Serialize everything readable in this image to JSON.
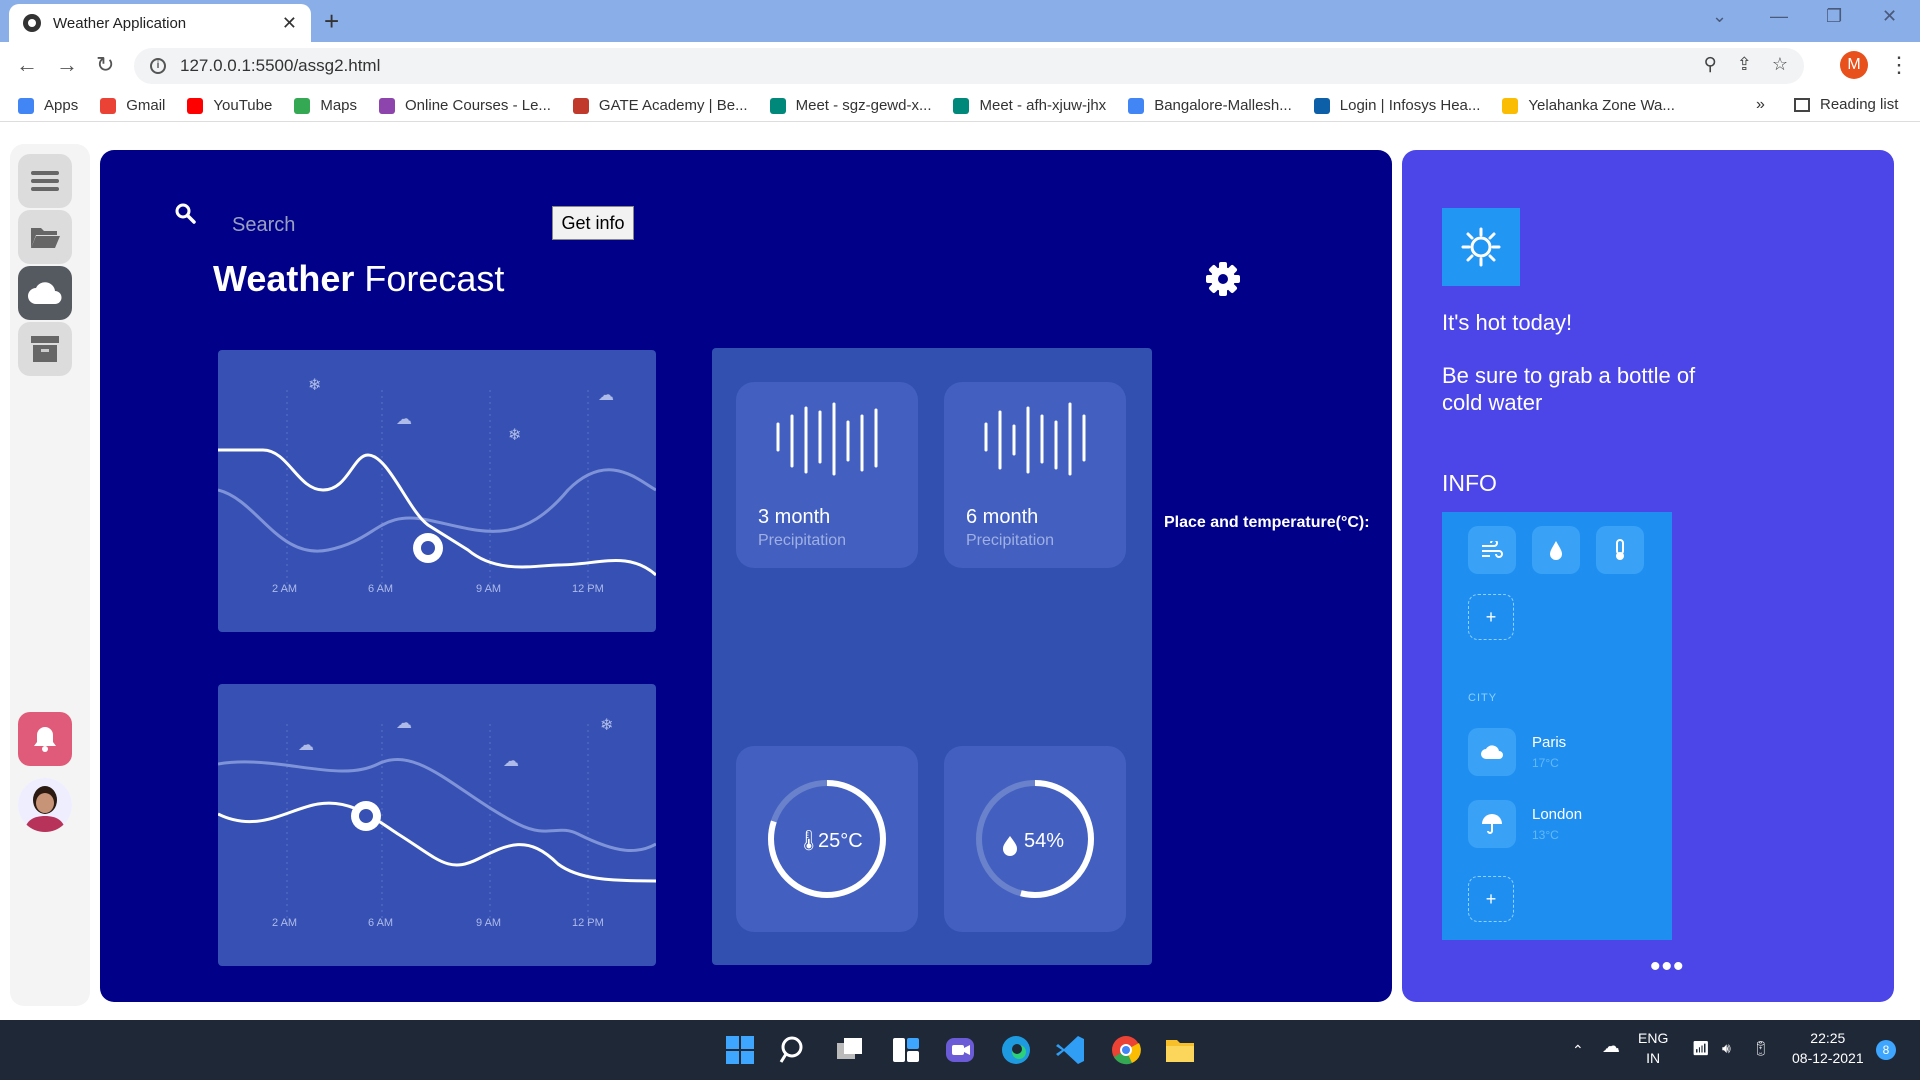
{
  "browser": {
    "tab_title": "Weather Application",
    "tab_close": "✕",
    "new_tab": "+",
    "url": "127.0.0.1:5500/assg2.html",
    "profile_initial": "M",
    "bookmarks": [
      {
        "label": "Apps",
        "color": "#4285f4"
      },
      {
        "label": "Gmail",
        "color": "#ea4335"
      },
      {
        "label": "YouTube",
        "color": "#ff0000"
      },
      {
        "label": "Maps",
        "color": "#34a853"
      },
      {
        "label": "Online Courses - Le...",
        "color": "#8e44ad"
      },
      {
        "label": "GATE Academy | Be...",
        "color": "#c0392b"
      },
      {
        "label": "Meet - sgz-gewd-x...",
        "color": "#00897b"
      },
      {
        "label": "Meet - afh-xjuw-jhx",
        "color": "#00897b"
      },
      {
        "label": "Bangalore-Mallesh...",
        "color": "#4285f4"
      },
      {
        "label": "Login | Infosys Hea...",
        "color": "#0d5fa8"
      },
      {
        "label": "Yelahanka Zone Wa...",
        "color": "#fbbc04"
      }
    ],
    "bookmarks_more": "»",
    "reading_list": "Reading list"
  },
  "app": {
    "search_placeholder": "Search",
    "get_info_label": "Get info",
    "title_bold": "Weather",
    "title_rest": " Forecast",
    "chart1_times": [
      "2 AM",
      "6 AM",
      "9 AM",
      "12 PM"
    ],
    "chart2_times": [
      "2 AM",
      "6 AM",
      "9 AM",
      "12 PM"
    ],
    "stats": [
      {
        "title": "3 month",
        "sub": "Precipitation"
      },
      {
        "title": "6 month",
        "sub": "Precipitation"
      }
    ],
    "temperature": "25°C",
    "temperature_level": 0.8,
    "humidity": "54%",
    "humidity_level": 0.54,
    "place_temp_label": "Place and temperature(°C):"
  },
  "panel": {
    "hot_text": "It's hot today!",
    "advice": "Be sure to grab a bottle of cold water",
    "info_label": "INFO",
    "city_label": "CITY",
    "cities": [
      {
        "name": "Paris",
        "temp": "17°C"
      },
      {
        "name": "London",
        "temp": "13°C"
      }
    ],
    "plus": "+",
    "more": "•••"
  },
  "taskbar": {
    "lang_line1": "ENG",
    "lang_line2": "IN",
    "time": "22:25",
    "date": "08-12-2021",
    "notif_count": "8"
  }
}
